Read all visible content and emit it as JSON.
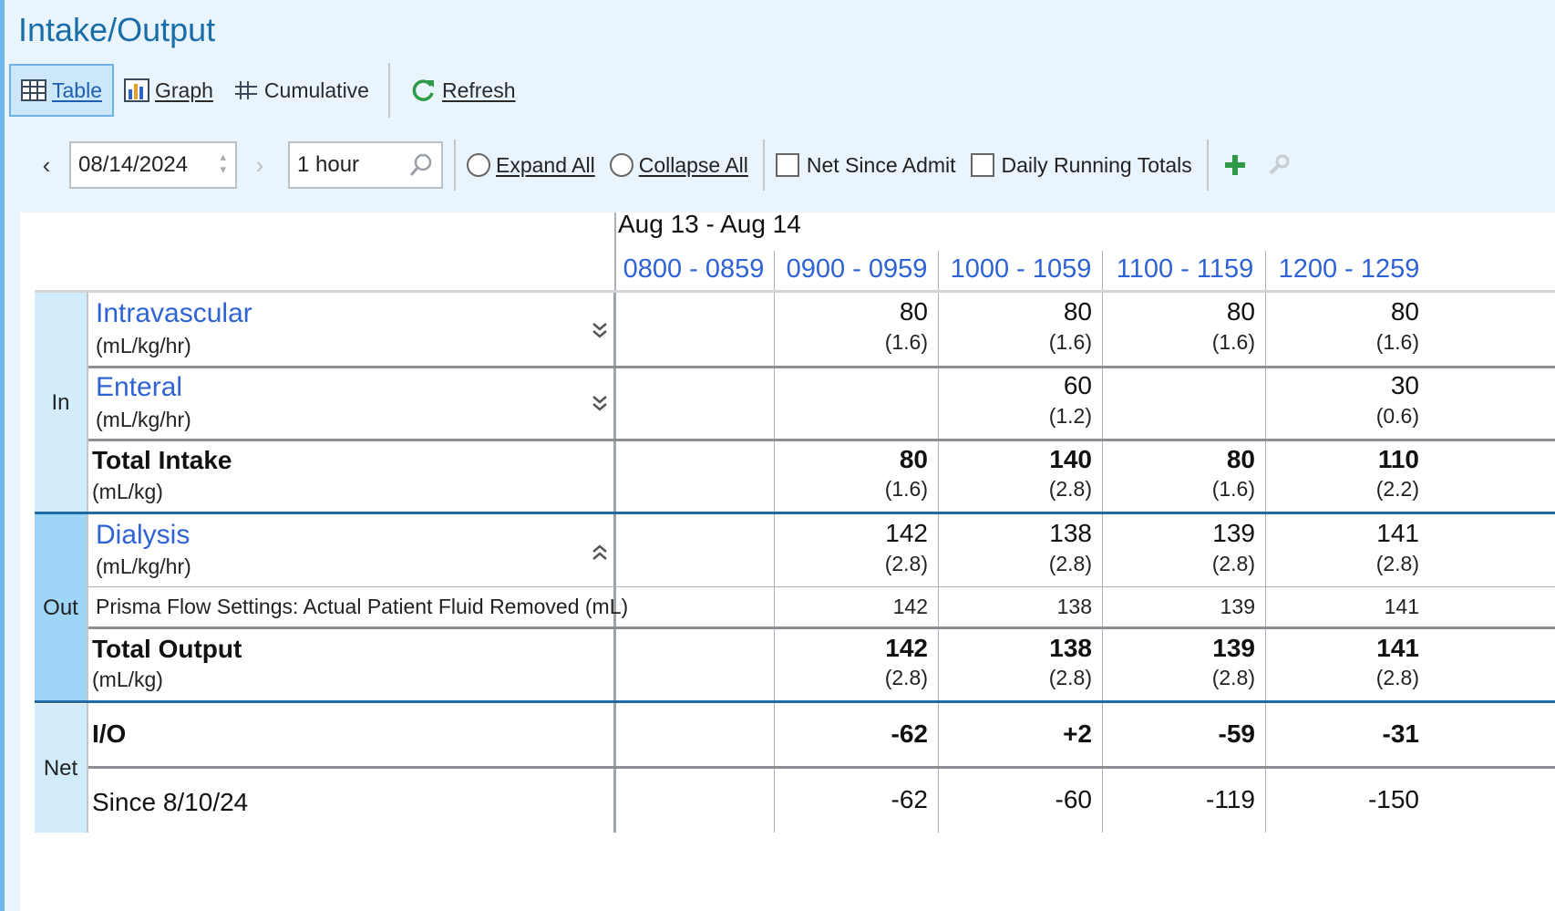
{
  "title": "Intake/Output",
  "toolbar": {
    "table": "Table",
    "graph": "Graph",
    "cumulative": "Cumulative",
    "refresh": "Refresh"
  },
  "filters": {
    "date": "08/14/2024",
    "interval": "1 hour",
    "expand_all": "Expand All",
    "collapse_all": "Collapse All",
    "net_since_admit": "Net Since Admit",
    "daily_running_totals": "Daily Running Totals"
  },
  "table": {
    "date_range": "Aug 13 - Aug 14",
    "columns": [
      "0800 - 0859",
      "0900 - 0959",
      "1000 - 1059",
      "1100 - 1159",
      "1200 - 1259"
    ],
    "groups": {
      "in": "In",
      "out": "Out",
      "net": "Net"
    },
    "rows": {
      "intravascular": {
        "label": "Intravascular",
        "unit": "(mL/kg/hr)",
        "values": [
          "",
          "80",
          "80",
          "80",
          "80"
        ],
        "sub": [
          "",
          "(1.6)",
          "(1.6)",
          "(1.6)",
          "(1.6)"
        ]
      },
      "enteral": {
        "label": "Enteral",
        "unit": "(mL/kg/hr)",
        "values": [
          "",
          "",
          "60",
          "",
          "30"
        ],
        "sub": [
          "",
          "",
          "(1.2)",
          "",
          "(0.6)"
        ]
      },
      "total_intake": {
        "label": "Total Intake",
        "unit": "(mL/kg)",
        "values": [
          "",
          "80",
          "140",
          "80",
          "110"
        ],
        "sub": [
          "",
          "(1.6)",
          "(2.8)",
          "(1.6)",
          "(2.2)"
        ]
      },
      "dialysis": {
        "label": "Dialysis",
        "unit": "(mL/kg/hr)",
        "values": [
          "",
          "142",
          "138",
          "139",
          "141"
        ],
        "sub": [
          "",
          "(2.8)",
          "(2.8)",
          "(2.8)",
          "(2.8)"
        ]
      },
      "prisma": {
        "label": "Prisma Flow Settings: Actual Patient Fluid Removed (mL)",
        "values": [
          "",
          "142",
          "138",
          "139",
          "141"
        ]
      },
      "total_output": {
        "label": "Total Output",
        "unit": "(mL/kg)",
        "values": [
          "",
          "142",
          "138",
          "139",
          "141"
        ],
        "sub": [
          "",
          "(2.8)",
          "(2.8)",
          "(2.8)",
          "(2.8)"
        ]
      },
      "io": {
        "label": "I/O",
        "values": [
          "",
          "-62",
          "+2",
          "-59",
          "-31"
        ]
      },
      "since": {
        "label": "Since 8/10/24",
        "values": [
          "",
          "-62",
          "-60",
          "-119",
          "-150"
        ]
      }
    }
  }
}
